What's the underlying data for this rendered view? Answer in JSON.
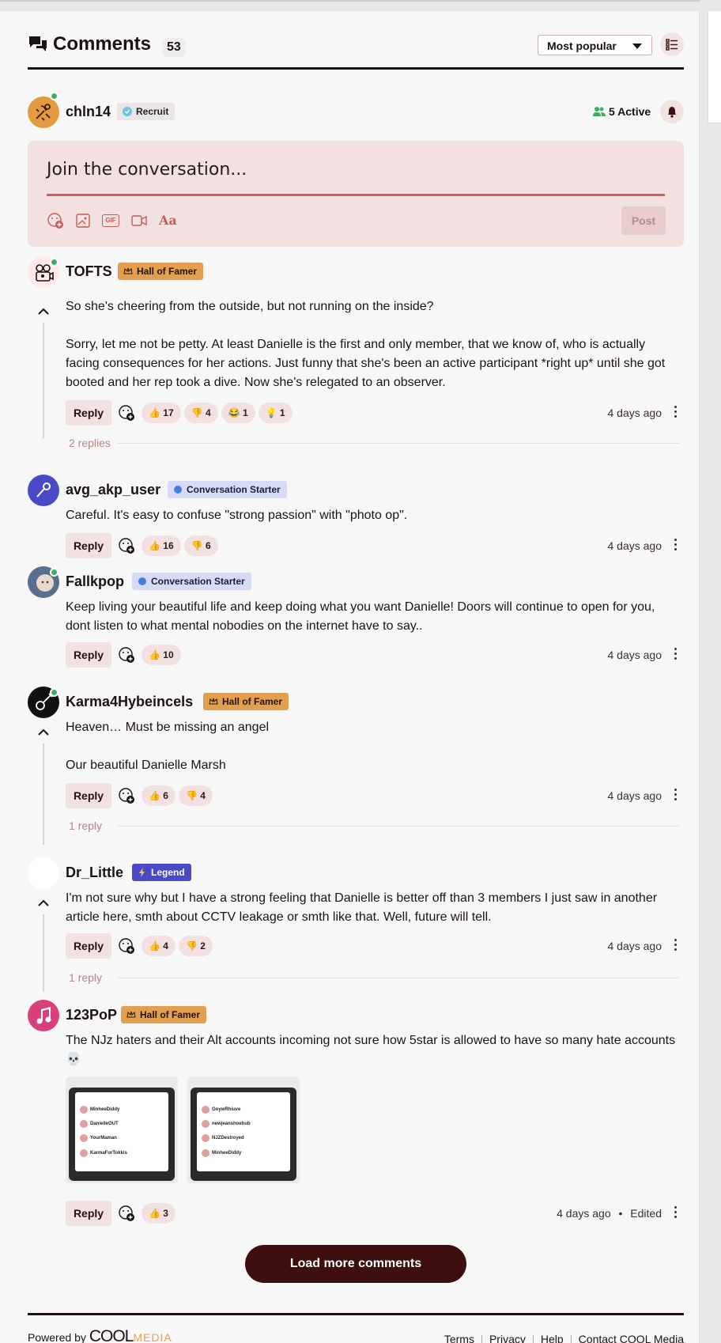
{
  "header": {
    "title": "Comments",
    "count": "53",
    "sort_label": "Most popular"
  },
  "me": {
    "username": "chln14",
    "badge": "Recruit",
    "active_label": "5 Active"
  },
  "composer": {
    "placeholder": "Join the conversation...",
    "gif_label": "GIF",
    "text_label": "Aa",
    "post_label": "Post"
  },
  "actions": {
    "reply_label": "Reply"
  },
  "comments": [
    {
      "username": "TOFTS",
      "badge": "Hall of Famer",
      "paragraphs": [
        "So she's cheering from the outside, but not running on the inside?",
        "",
        "Sorry, let me not be petty. At least Danielle is the first and only member, that we know of, who is actually facing consequences for her actions. Just funny that she's been an active participant *right up* until she got booted and her rep took a dive. Now she's relegated to an observer."
      ],
      "reactions": [
        {
          "emoji": "👍",
          "count": "17"
        },
        {
          "emoji": "👎",
          "count": "4"
        },
        {
          "emoji": "😂",
          "count": "1"
        },
        {
          "emoji": "💡",
          "count": "1"
        }
      ],
      "time": "4 days ago",
      "replies": "2 replies"
    },
    {
      "username": "avg_akp_user",
      "badge": "Conversation Starter",
      "paragraphs": [
        "Careful. It's easy to confuse \"strong passion\" with \"photo op\"."
      ],
      "reactions": [
        {
          "emoji": "👍",
          "count": "16"
        },
        {
          "emoji": "👎",
          "count": "6"
        }
      ],
      "time": "4 days ago"
    },
    {
      "username": "Fallkpop",
      "badge": "Conversation Starter",
      "paragraphs": [
        "Keep living your beautiful life and keep doing what you want Danielle! Doors will continue to open for you, dont listen to what mental nobodies on the internet have to say.."
      ],
      "reactions": [
        {
          "emoji": "👍",
          "count": "10"
        }
      ],
      "time": "4 days ago"
    },
    {
      "username": "Karma4Hybeincels",
      "badge": "Hall of Famer",
      "paragraphs": [
        "Heaven… Must be missing an angel",
        "",
        "Our beautiful Danielle Marsh"
      ],
      "reactions": [
        {
          "emoji": "👍",
          "count": "6"
        },
        {
          "emoji": "👎",
          "count": "4"
        }
      ],
      "time": "4 days ago",
      "replies": "1 reply"
    },
    {
      "username": "Dr_Little",
      "badge": "Legend",
      "paragraphs": [
        "I'm not sure why but I have a strong feeling that Danielle is better off than 3 members I just saw in another article here, smth about CCTV leakage or smth like that. Well, future will tell."
      ],
      "reactions": [
        {
          "emoji": "👍",
          "count": "4"
        },
        {
          "emoji": "👎",
          "count": "2"
        }
      ],
      "time": "4 days ago",
      "replies": "1 reply"
    },
    {
      "username": "123PoP",
      "badge": "Hall of Famer",
      "paragraphs": [
        "The NJz haters and their Alt accounts incoming not sure how 5star is allowed to have so many hate accounts 💀"
      ],
      "reactions": [
        {
          "emoji": "👍",
          "count": "3"
        }
      ],
      "time": "4 days ago",
      "edited": "Edited",
      "dot": "•",
      "attachments": [
        {
          "rows": [
            "MinheeDiddy",
            "DanielleOUT",
            "YourMaman",
            "KarmaForTokkis"
          ]
        },
        {
          "rows": [
            "GoywRhiuve",
            "newjeanshoehub",
            "NJZDestroyed",
            "MinheeDiddy"
          ]
        }
      ]
    }
  ],
  "load_more": "Load more comments",
  "footer": {
    "powered": "Powered by",
    "brand_a": "COOL",
    "brand_b": "MEDIA",
    "links": [
      "Terms",
      "Privacy",
      "Help",
      "Contact COOL Media"
    ]
  },
  "colors": {
    "accent": "#3d0f0f",
    "hof": "#e2a04f",
    "legend": "#4a49c8",
    "online": "#3fae5a"
  }
}
